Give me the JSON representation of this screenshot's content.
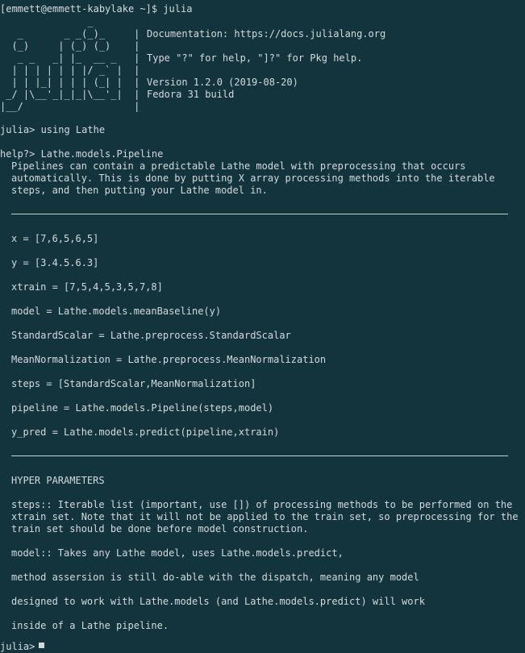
{
  "shell_prompt": "[emmett@emmett-kabylake ~]$ julia",
  "banner": {
    "logo": "               _\n   _       _ _(_)_     |\n  (_)     | (_) (_)    |\n   _ _   _| |_  __ _   |\n  | | | | | | |/ _` |  |\n  | | |_| | | | (_| |  |\n _/ |\\__'_|_|_|\\__'_|  |\n|__/                   |",
    "info_doc": "Documentation: https://docs.julialang.org",
    "info_help": "Type \"?\" for help, \"]?\" for Pkg help.",
    "info_version": "Version 1.2.0 (2019-08-20)",
    "info_build": "Fedora 31 build"
  },
  "repl": {
    "using_line": "julia> using Lathe",
    "help_line": "help?> Lathe.models.Pipeline",
    "intro": [
      "Pipelines can contain a predictable Lathe model with preprocessing that occurs",
      "automatically. This is done by putting X array processing methods into the iterable",
      "steps, and then putting your Lathe model in."
    ],
    "code": [
      "x = [7,6,5,6,5]",
      "y = [3.4.5.6.3]",
      "xtrain = [7,5,4,5,3,5,7,8]",
      "model = Lathe.models.meanBaseline(y)",
      "StandardScalar = Lathe.preprocess.StandardScalar",
      "MeanNormalization = Lathe.preprocess.MeanNormalization",
      "steps = [StandardScalar,MeanNormalization]",
      "pipeline = Lathe.models.Pipeline(steps,model)",
      "y_pred = Lathe.models.predict(pipeline,xtrain)"
    ],
    "hyper_heading": "HYPER PARAMETERS",
    "steps_desc": [
      "steps:: Iterable list (important, use []) of processing methods to be performed on the",
      "xtrain set. Note that it will not be applied to the train set, so preprocessing for the",
      "train set should be done before model construction."
    ],
    "model_desc": [
      "model:: Takes any Lathe model, uses Lathe.models.predict,",
      "method assersion is still do-able with the dispatch, meaning any model",
      "designed to work with Lathe.models (and Lathe.models.predict) will work",
      "inside of a Lathe pipeline."
    ],
    "final_prompt": "julia> "
  }
}
